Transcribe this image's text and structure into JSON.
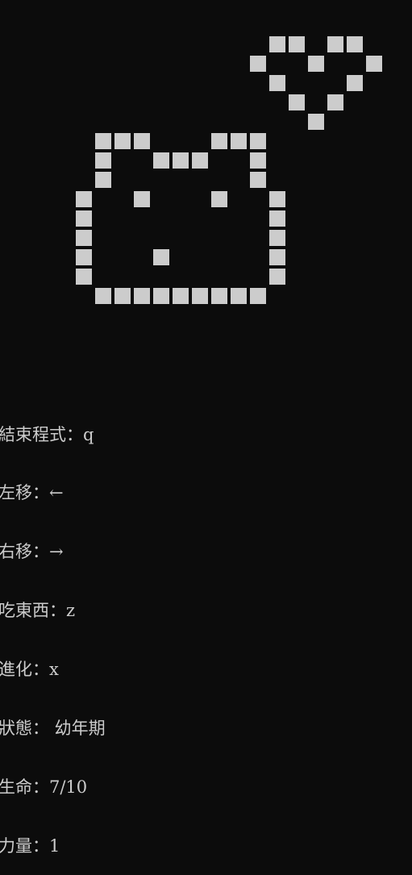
{
  "sprites": {
    "heart": {
      "name": "heart-sprite",
      "rows": [
        ".XX.XX.",
        "X..X..X",
        ".X...X.",
        "..X.X..",
        "...X..."
      ]
    },
    "pet": {
      "name": "pet-sprite",
      "rows": [
        ".XXX...XXX.",
        ".X..XXX..X.",
        ".X.......X.",
        "X..X...X..X",
        "X.........X",
        "X.........X",
        "X...X.....X",
        "X.........X",
        ".XXXXXXXXX."
      ]
    },
    "pixel_color": "#cccccc",
    "background_color": "#0c0c0c"
  },
  "controls": {
    "quit": "結束程式：q",
    "left": "左移：←",
    "right": "右移：→",
    "eat": "吃東西：z",
    "evolve": "進化：x"
  },
  "status": {
    "state": "狀態： 幼年期",
    "life": "生命：7/10",
    "power": "力量：1"
  }
}
